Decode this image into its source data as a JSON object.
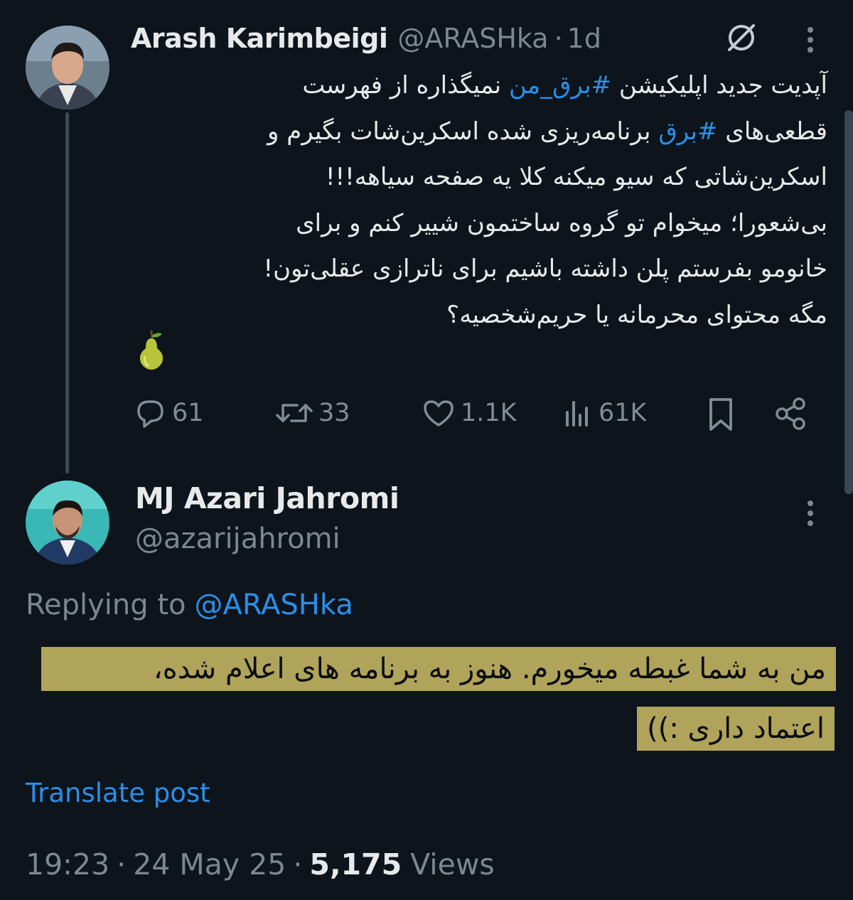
{
  "tweet": {
    "author_name": "Arash Karimbeigi",
    "author_handle": "@ARASHka",
    "separator": "·",
    "time_ago": "1d",
    "body_lines": [
      {
        "before": "آپدیت جدید اپلیکیشن ",
        "tag": "#برق_من",
        "after": " نمیگذاره از فهرست"
      },
      {
        "before": "قطعی‌های ",
        "tag": "#برق",
        "after": " برنامه‌ریزی شده اسکرین‌شات بگیرم و"
      },
      {
        "before": "اسکرین‌شاتی که سیو میکنه کلا یه صفحه سیاهه!!!",
        "tag": "",
        "after": ""
      },
      {
        "before": "بی‌شعورا؛ میخوام تو گروه ساختمون شییر کنم و برای",
        "tag": "",
        "after": ""
      },
      {
        "before": "خانومو بفرستم پلن داشته باشیم برای ناترازی عقلی‌تون!",
        "tag": "",
        "after": ""
      },
      {
        "before": "مگه محتوای محرمانه یا حریم‌شخصیه؟",
        "tag": "",
        "after": ""
      }
    ],
    "emoji": "🍐",
    "stats": {
      "replies": "61",
      "reposts": "33",
      "likes": "1.1K",
      "views": "61K"
    }
  },
  "reply": {
    "author_name": "MJ Azari Jahromi",
    "author_handle": "@azarijahromi",
    "replying_prefix": "Replying to",
    "replying_to": "@ARASHka",
    "body_lines": [
      "من به شما غبطه میخورم. هنوز به برنامه های اعلام شده،",
      "اعتماد داری :))"
    ],
    "translate_label": "Translate post",
    "time": "19:23",
    "date": "24 May 25",
    "views_count": "5,175",
    "views_label": "Views"
  },
  "colors": {
    "background": "#0d141b",
    "accent_blue": "#2b8fe8",
    "muted_gray": "#7d8790",
    "highlight": "#b0a35a"
  },
  "icons": [
    "grok-icon",
    "more-icon",
    "reply-icon",
    "repost-icon",
    "like-icon",
    "views-icon",
    "bookmark-icon",
    "share-icon"
  ]
}
